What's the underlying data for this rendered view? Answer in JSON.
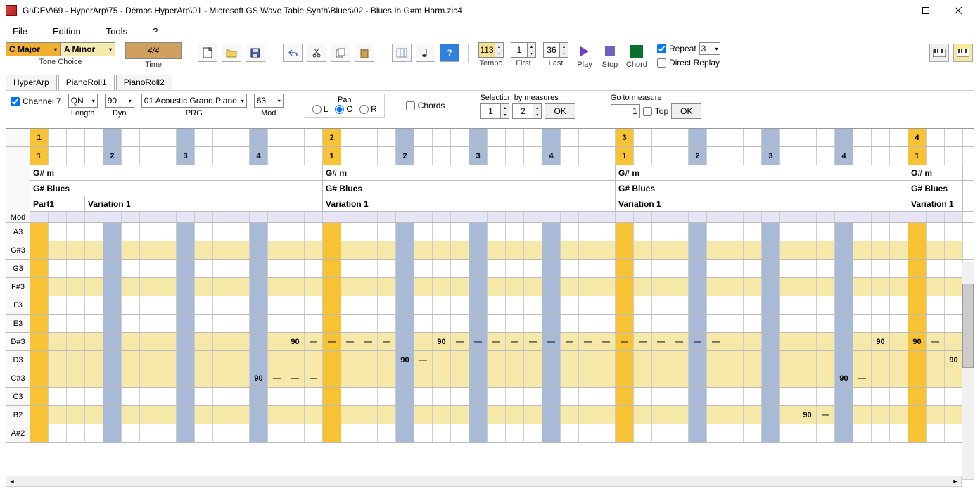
{
  "title": "G:\\DEV\\69 - HyperArp\\75 - Démos HyperArp\\01  - Microsoft GS Wave Table Synth\\Blues\\02 - Blues In G#m Harm.zic4",
  "menu": {
    "file": "File",
    "edition": "Edition",
    "tools": "Tools",
    "help": "?"
  },
  "tone": {
    "major": "C Major",
    "minor": "A Minor",
    "label": "Tone Choice"
  },
  "time": {
    "value": "4/4",
    "label": "Time"
  },
  "tempo": {
    "value": "113",
    "label": "Tempo"
  },
  "first": {
    "value": "1",
    "label": "First"
  },
  "last": {
    "value": "36",
    "label": "Last"
  },
  "play": "Play",
  "stop": "Stop",
  "chord": "Chord",
  "repeat": {
    "label": "Repeat",
    "value": "3",
    "direct": "Direct Replay"
  },
  "tabs": {
    "hyperarp": "HyperArp",
    "pr1": "PianoRoll1",
    "pr2": "PianoRoll2"
  },
  "channel": {
    "label": "Channel 7"
  },
  "length": {
    "value": "QN",
    "label": "Length"
  },
  "dyn": {
    "value": "90",
    "label": "Dyn"
  },
  "prg": {
    "value": "01 Acoustic Grand Piano",
    "label": "PRG"
  },
  "mod": {
    "value": "63",
    "label": "Mod"
  },
  "pan": {
    "title": "Pan",
    "l": "L",
    "c": "C",
    "r": "R"
  },
  "chords": "Chords",
  "selection": {
    "title": "Selection by measures",
    "from": "1",
    "to": "2",
    "ok": "OK"
  },
  "goto": {
    "title": "Go to measure",
    "value": "1",
    "top": "Top",
    "ok": "OK"
  },
  "beats_top": [
    {
      "pos": 0,
      "val": "1",
      "c": "y"
    },
    {
      "pos": 16,
      "val": "2",
      "c": "y"
    },
    {
      "pos": 32,
      "val": "3",
      "c": "y"
    },
    {
      "pos": 48,
      "val": "4",
      "c": "y"
    }
  ],
  "beats_bot": [
    {
      "pos": 0,
      "val": "1",
      "c": "y"
    },
    {
      "pos": 4,
      "val": "2",
      "c": "b"
    },
    {
      "pos": 8,
      "val": "3",
      "c": "b"
    },
    {
      "pos": 12,
      "val": "4",
      "c": "b"
    },
    {
      "pos": 16,
      "val": "1",
      "c": "y"
    },
    {
      "pos": 20,
      "val": "2",
      "c": "b"
    },
    {
      "pos": 24,
      "val": "3",
      "c": "b"
    },
    {
      "pos": 28,
      "val": "4",
      "c": "b"
    },
    {
      "pos": 32,
      "val": "1",
      "c": "y"
    },
    {
      "pos": 36,
      "val": "2",
      "c": "b"
    },
    {
      "pos": 40,
      "val": "3",
      "c": "b"
    },
    {
      "pos": 44,
      "val": "4",
      "c": "b"
    },
    {
      "pos": 48,
      "val": "1",
      "c": "y"
    }
  ],
  "strips": {
    "chord": "G# m",
    "scale": "G# Blues",
    "part": "Part1",
    "variation": "Variation 1"
  },
  "rows": [
    "Mod",
    "A3",
    "G#3",
    "G3",
    "F#3",
    "F3",
    "E3",
    "D#3",
    "D3",
    "C#3",
    "C3",
    "B2",
    "A#2"
  ],
  "shaded_rows": [
    "G#3",
    "F#3",
    "D#3",
    "D3",
    "C#3",
    "B2"
  ],
  "chart_data": {
    "type": "pianoroll",
    "measures": 4,
    "beats_per_measure": 4,
    "subdivisions_per_beat": 4,
    "velocity_shown": 90,
    "highlighted_rows": [
      "G#3",
      "F#3",
      "D#3",
      "D3",
      "C#3",
      "B2"
    ],
    "notes": [
      {
        "row": "C#3",
        "pos": 12,
        "vel": 90
      },
      {
        "row": "C#3",
        "pos": 13
      },
      {
        "row": "C#3",
        "pos": 14
      },
      {
        "row": "C#3",
        "pos": 15
      },
      {
        "row": "D#3",
        "pos": 14,
        "vel": 90
      },
      {
        "row": "D#3",
        "pos": 15
      },
      {
        "row": "D#3",
        "pos": 16
      },
      {
        "row": "D#3",
        "pos": 17
      },
      {
        "row": "D#3",
        "pos": 18
      },
      {
        "row": "D#3",
        "pos": 19
      },
      {
        "row": "D3",
        "pos": 20,
        "vel": 90
      },
      {
        "row": "D3",
        "pos": 21
      },
      {
        "row": "D#3",
        "pos": 22,
        "vel": 90
      },
      {
        "row": "D#3",
        "pos": 23
      },
      {
        "row": "D#3",
        "pos": 24
      },
      {
        "row": "D#3",
        "pos": 25
      },
      {
        "row": "D#3",
        "pos": 26
      },
      {
        "row": "D#3",
        "pos": 27
      },
      {
        "row": "D#3",
        "pos": 28
      },
      {
        "row": "D#3",
        "pos": 29
      },
      {
        "row": "D#3",
        "pos": 30
      },
      {
        "row": "D#3",
        "pos": 31
      },
      {
        "row": "D#3",
        "pos": 32
      },
      {
        "row": "D#3",
        "pos": 33
      },
      {
        "row": "D#3",
        "pos": 34
      },
      {
        "row": "D#3",
        "pos": 35
      },
      {
        "row": "D#3",
        "pos": 36
      },
      {
        "row": "D#3",
        "pos": 37
      },
      {
        "row": "B2",
        "pos": 42,
        "vel": 90
      },
      {
        "row": "B2",
        "pos": 43
      },
      {
        "row": "C#3",
        "pos": 44,
        "vel": 90
      },
      {
        "row": "C#3",
        "pos": 45
      },
      {
        "row": "D#3",
        "pos": 46,
        "vel": 90
      },
      {
        "row": "D#3",
        "pos": 48,
        "vel": 90
      },
      {
        "row": "D#3",
        "pos": 49
      },
      {
        "row": "D3",
        "pos": 50,
        "vel": 90
      }
    ]
  }
}
